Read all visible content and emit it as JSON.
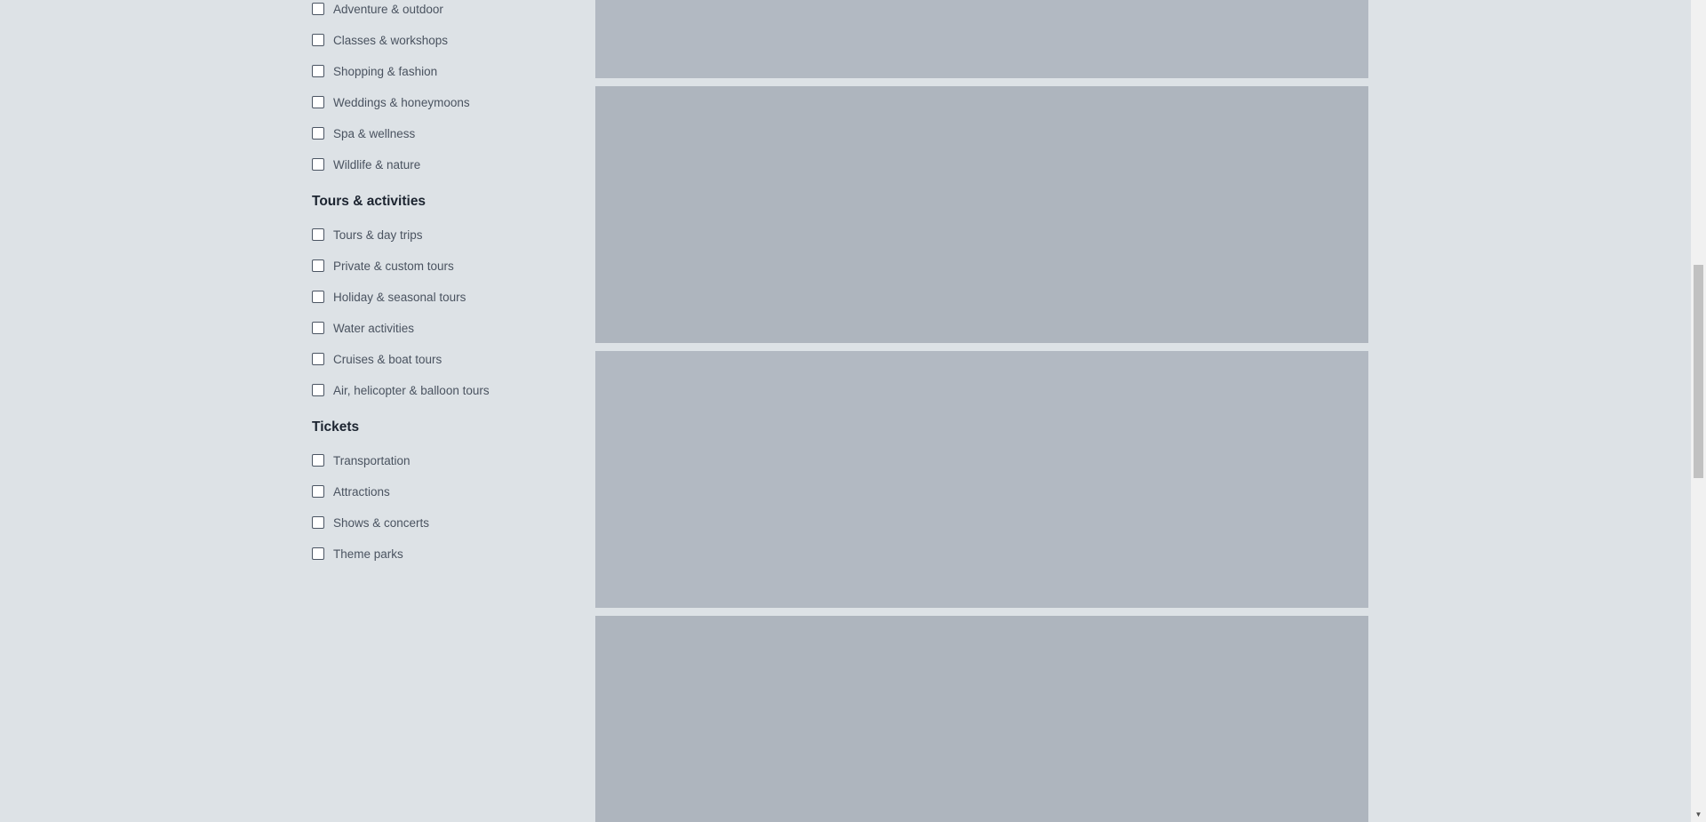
{
  "filters": {
    "interests": [
      {
        "label": "Adventure & outdoor",
        "checked": false
      },
      {
        "label": "Classes & workshops",
        "checked": false
      },
      {
        "label": "Shopping & fashion",
        "checked": false
      },
      {
        "label": "Weddings & honeymoons",
        "checked": false
      },
      {
        "label": "Spa & wellness",
        "checked": false
      },
      {
        "label": "Wildlife & nature",
        "checked": false
      }
    ],
    "tours_heading": "Tours & activities",
    "tours": [
      {
        "label": "Tours & day trips",
        "checked": false
      },
      {
        "label": "Private & custom tours",
        "checked": false
      },
      {
        "label": "Holiday & seasonal tours",
        "checked": false
      },
      {
        "label": "Water activities",
        "checked": false
      },
      {
        "label": "Cruises & boat tours",
        "checked": false
      },
      {
        "label": "Air, helicopter & balloon tours",
        "checked": false
      }
    ],
    "tickets_heading": "Tickets",
    "tickets": [
      {
        "label": "Transportation",
        "checked": false
      },
      {
        "label": "Attractions",
        "checked": false
      },
      {
        "label": "Shows & concerts",
        "checked": false
      },
      {
        "label": "Theme parks",
        "checked": false
      }
    ]
  },
  "colors": {
    "page_background": "#dde2e6",
    "card_placeholder": "#aeb5be",
    "card_placeholder_alt": "#b2b9c2"
  },
  "icons": {
    "scroll_down": "down-arrow-icon"
  }
}
